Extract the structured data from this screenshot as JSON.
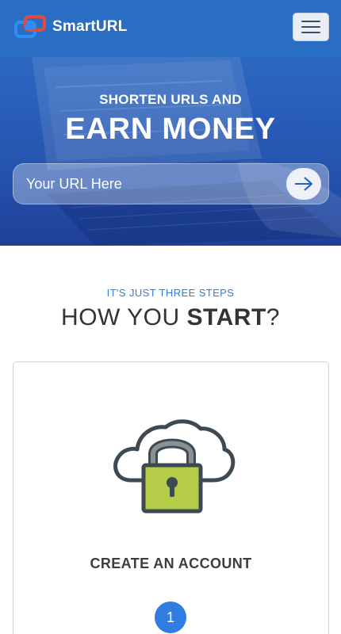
{
  "brand": {
    "name": "SmartURL"
  },
  "hero": {
    "subtitle": "SHORTEN URLS AND",
    "title": "EARN MONEY",
    "url_placeholder": "Your URL Here"
  },
  "steps": {
    "eyebrow": "IT'S JUST THREE STEPS",
    "heading_prefix": "HOW YOU ",
    "heading_bold": "START",
    "heading_suffix": "?",
    "cards": [
      {
        "title": "CREATE AN ACCOUNT",
        "number": "1",
        "icon": "cloud-lock-icon"
      }
    ]
  },
  "colors": {
    "accent": "#2f7de1",
    "hero_bg": "#2a6ec4",
    "lock_body": "#b5cc48"
  }
}
